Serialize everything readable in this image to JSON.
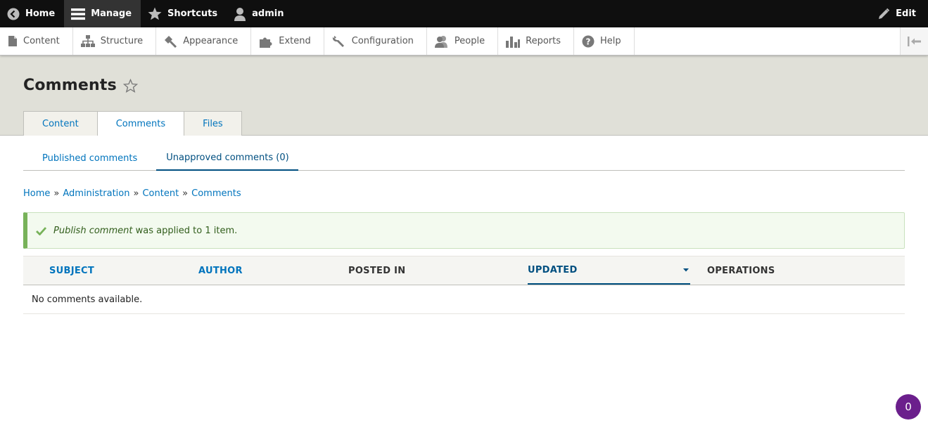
{
  "toolbar": {
    "home": "Home",
    "manage": "Manage",
    "shortcuts": "Shortcuts",
    "user": "admin",
    "edit": "Edit"
  },
  "tray": {
    "items": [
      {
        "label": "Content",
        "icon": "file-icon"
      },
      {
        "label": "Structure",
        "icon": "sitemap-icon"
      },
      {
        "label": "Appearance",
        "icon": "paint-brush-icon"
      },
      {
        "label": "Extend",
        "icon": "puzzle-icon"
      },
      {
        "label": "Configuration",
        "icon": "wrench-icon"
      },
      {
        "label": "People",
        "icon": "people-icon"
      },
      {
        "label": "Reports",
        "icon": "bar-chart-icon"
      },
      {
        "label": "Help",
        "icon": "help-icon"
      }
    ]
  },
  "page": {
    "title": "Comments"
  },
  "primary_tabs": [
    "Content",
    "Comments",
    "Files"
  ],
  "secondary_tabs": [
    "Published comments",
    "Unapproved comments (0)"
  ],
  "breadcrumb": [
    "Home",
    "Administration",
    "Content",
    "Comments"
  ],
  "breadcrumb_separator": "»",
  "status": {
    "action": "Publish comment",
    "rest": " was applied to 1 item."
  },
  "table": {
    "headers": [
      "Subject",
      "Author",
      "Posted in",
      "Updated",
      "Operations"
    ],
    "empty": "No comments available."
  },
  "badge": {
    "count": "0"
  },
  "colors": {
    "link": "#0074bd",
    "active": "#004f80",
    "success": "#77b259",
    "badge": "#6b1f8c"
  }
}
